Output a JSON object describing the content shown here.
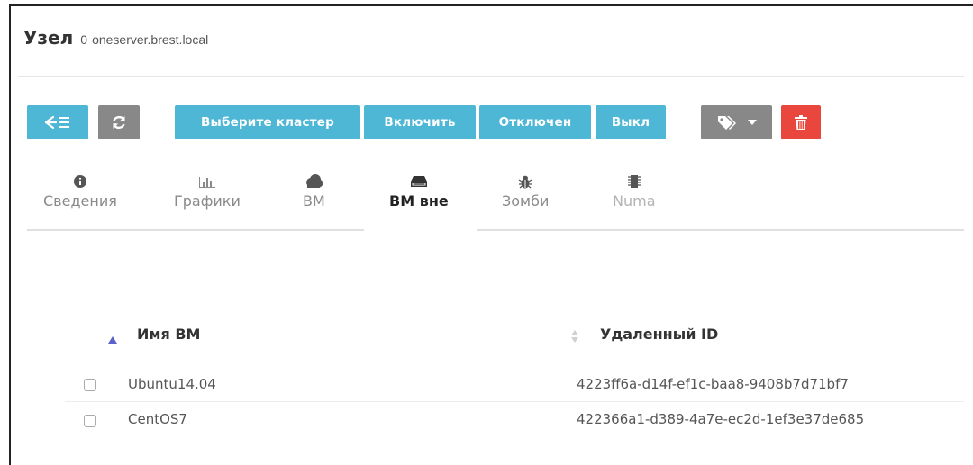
{
  "header": {
    "title": "Узел",
    "node_id": "0",
    "host": "oneserver.brest.local"
  },
  "toolbar": {
    "back_icon": "back-list-icon",
    "refresh_icon": "refresh-icon",
    "select_cluster": "Выберите кластер",
    "enable": "Включить",
    "disable": "Отключен",
    "off": "Выкл",
    "labels_icon": "tags-icon",
    "delete_icon": "trash-icon",
    "colors": {
      "teal": "#4fb7d6",
      "gray": "#888888",
      "red": "#e9473d"
    }
  },
  "tabs": [
    {
      "label": "Сведения",
      "icon": "info-icon"
    },
    {
      "label": "Графики",
      "icon": "bar-chart-icon"
    },
    {
      "label": "ВМ",
      "icon": "cloud-icon"
    },
    {
      "label": "ВМ вне",
      "icon": "hdd-icon",
      "active": true
    },
    {
      "label": "Зомби",
      "icon": "bug-icon"
    },
    {
      "label": "Numa",
      "icon": "chip-icon"
    }
  ],
  "table": {
    "columns": [
      "Имя ВМ",
      "Удаленный ID"
    ],
    "rows": [
      {
        "name": "Ubuntu14.04",
        "remote_id": "4223ff6a-d14f-ef1c-baa8-9408b7d71bf7"
      },
      {
        "name": "CentOS7",
        "remote_id": "422366a1-d389-4a7e-ec2d-1ef3e37de685"
      }
    ]
  }
}
